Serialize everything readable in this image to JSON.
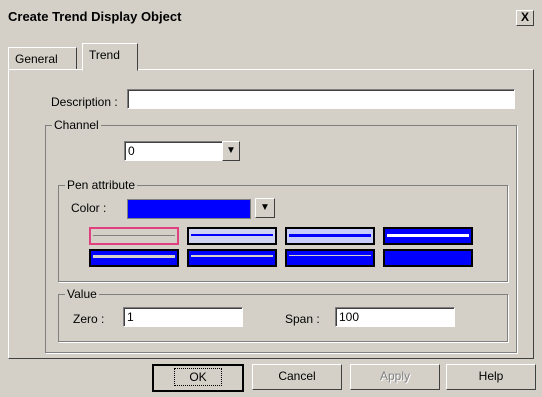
{
  "window": {
    "title": "Create Trend Display Object",
    "close_label": "X"
  },
  "tabs": [
    {
      "label": "General"
    },
    {
      "label": "Trend"
    }
  ],
  "description": {
    "label": "Description :",
    "value": ""
  },
  "channel": {
    "group_label": "Channel",
    "value": "0"
  },
  "pen": {
    "group_label": "Pen attribute",
    "color_label": "Color :",
    "color_value": "#0000ff"
  },
  "value_group": {
    "group_label": "Value",
    "zero_label": "Zero :",
    "zero_value": "1",
    "span_label": "Span :",
    "span_value": "100"
  },
  "buttons": {
    "ok": "OK",
    "cancel": "Cancel",
    "apply": "Apply",
    "help": "Help"
  }
}
